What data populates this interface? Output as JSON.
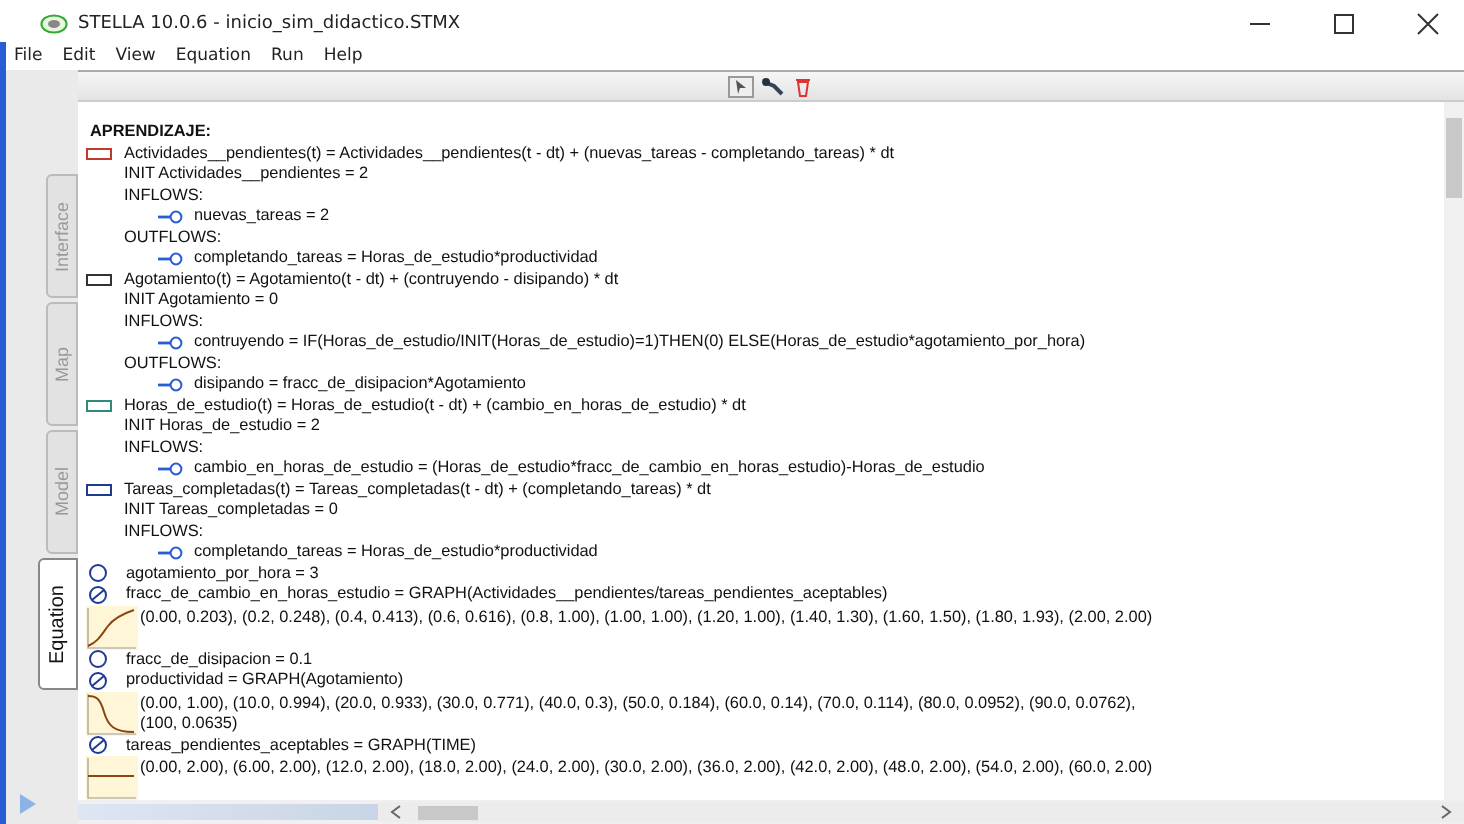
{
  "window": {
    "title": "STELLA 10.0.6 - inicio_sim_didactico.STMX"
  },
  "menu": [
    "File",
    "Edit",
    "View",
    "Equation",
    "Run",
    "Help"
  ],
  "side_tabs": [
    {
      "label": "Interface",
      "selected": false
    },
    {
      "label": "Map",
      "selected": false
    },
    {
      "label": "Model",
      "selected": false
    },
    {
      "label": "Equation",
      "selected": true
    }
  ],
  "section": "APRENDIZAJE:",
  "entries": [
    {
      "kind": "stock",
      "color": "#c0392b",
      "text": "Actividades__pendientes(t) = Actividades__pendientes(t - dt) + (nuevas_tareas - completando_tareas) * dt"
    },
    {
      "kind": "init",
      "text": "INIT Actividades__pendientes = 2"
    },
    {
      "kind": "header",
      "text": "INFLOWS:"
    },
    {
      "kind": "flow",
      "text": "nuevas_tareas = 2"
    },
    {
      "kind": "header",
      "text": "OUTFLOWS:"
    },
    {
      "kind": "flow",
      "text": "completando_tareas = Horas_de_estudio*productividad"
    },
    {
      "kind": "stock",
      "color": "#333333",
      "text": "Agotamiento(t) = Agotamiento(t - dt) + (contruyendo - disipando) * dt"
    },
    {
      "kind": "init",
      "text": "INIT Agotamiento = 0"
    },
    {
      "kind": "header",
      "text": "INFLOWS:"
    },
    {
      "kind": "flow",
      "text": "contruyendo = IF(Horas_de_estudio/INIT(Horas_de_estudio)=1)THEN(0) ELSE(Horas_de_estudio*agotamiento_por_hora)"
    },
    {
      "kind": "header",
      "text": "OUTFLOWS:"
    },
    {
      "kind": "flow",
      "text": "disipando = fracc_de_disipacion*Agotamiento"
    },
    {
      "kind": "stock",
      "color": "#2e8b7a",
      "text": "Horas_de_estudio(t) = Horas_de_estudio(t - dt) + (cambio_en_horas_de_estudio) * dt"
    },
    {
      "kind": "init",
      "text": "INIT Horas_de_estudio = 2"
    },
    {
      "kind": "header",
      "text": "INFLOWS:"
    },
    {
      "kind": "flow",
      "text": "cambio_en_horas_de_estudio = (Horas_de_estudio*fracc_de_cambio_en_horas_estudio)-Horas_de_estudio"
    },
    {
      "kind": "stock",
      "color": "#1f3a93",
      "text": "Tareas_completadas(t) = Tareas_completadas(t - dt) + (completando_tareas) * dt"
    },
    {
      "kind": "init",
      "text": "INIT Tareas_completadas = 0"
    },
    {
      "kind": "header",
      "text": "INFLOWS:"
    },
    {
      "kind": "flow",
      "text": "completando_tareas = Horas_de_estudio*productividad"
    },
    {
      "kind": "converter",
      "text": "agotamiento_por_hora = 3"
    },
    {
      "kind": "graph",
      "text": "fracc_de_cambio_en_horas_estudio = GRAPH(Actividades__pendientes/tareas_pendientes_aceptables)",
      "thumbnail": {
        "kind": "rising"
      },
      "points": [
        "(0.00, 0.203), (0.2, 0.248), (0.4, 0.413), (0.6, 0.616), (0.8, 1.00), (1.00, 1.00), (1.20, 1.00), (1.40, 1.30), (1.60, 1.50), (1.80, 1.93), (2.00, 2.00)"
      ]
    },
    {
      "kind": "converter",
      "text": "fracc_de_disipacion = 0.1"
    },
    {
      "kind": "graph",
      "text": "productividad = GRAPH(Agotamiento)",
      "thumbnail": {
        "kind": "falling"
      },
      "points": [
        "(0.00, 1.00), (10.0, 0.994), (20.0, 0.933), (30.0, 0.771), (40.0, 0.3), (50.0, 0.184), (60.0, 0.14), (70.0, 0.114), (80.0, 0.0952), (90.0, 0.0762),",
        "(100, 0.0635)"
      ]
    },
    {
      "kind": "graph",
      "text": "tareas_pendientes_aceptables = GRAPH(TIME)",
      "thumbnail": {
        "kind": "flat"
      },
      "points": [
        "(0.00, 2.00), (6.00, 2.00), (12.0, 2.00), (18.0, 2.00), (24.0, 2.00), (30.0, 2.00), (36.0, 2.00), (42.0, 2.00), (48.0, 2.00), (54.0, 2.00), (60.0, 2.00)"
      ]
    }
  ]
}
